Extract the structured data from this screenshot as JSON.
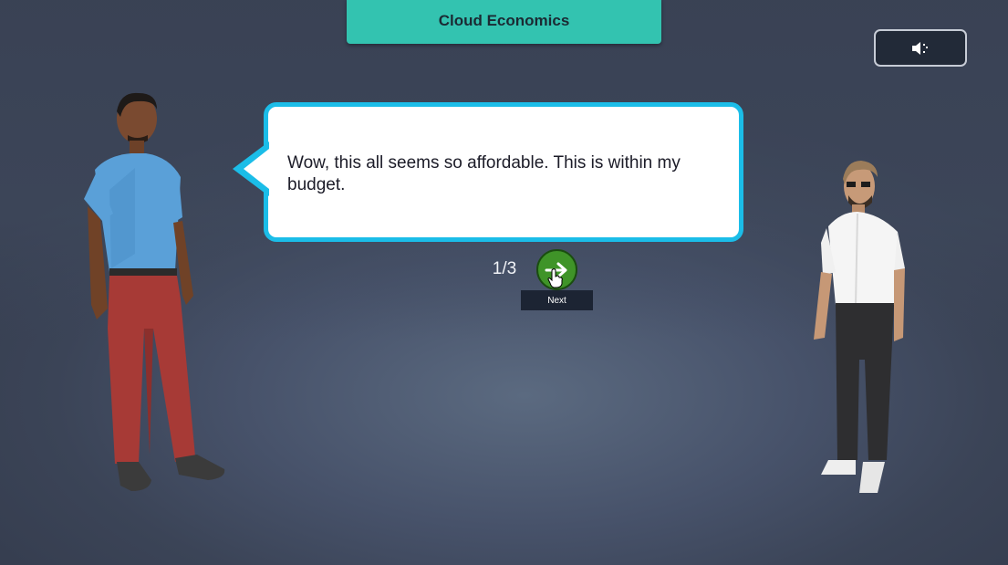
{
  "header": {
    "title": "Cloud Economics"
  },
  "controls": {
    "sound_icon": "speaker-icon"
  },
  "dialogue": {
    "text": "Wow, this all seems so affordable. This is within my budget.",
    "counter": "1/3",
    "next_tooltip": "Next",
    "next_icon": "arrow-right-icon"
  },
  "colors": {
    "banner": "#33c3b0",
    "bubble_border": "#1bbde8",
    "next_button": "#3f9428",
    "background": "#47526a"
  }
}
